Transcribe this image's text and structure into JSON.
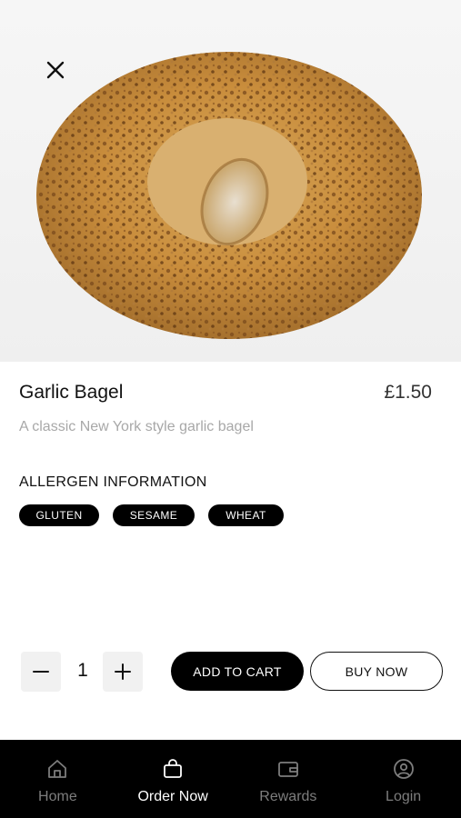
{
  "hero": {
    "image_name": "garlic-bagel-photo",
    "close_icon": "close-icon"
  },
  "product": {
    "name": "Garlic Bagel",
    "price": "£1.50",
    "description": "A classic New York style garlic bagel"
  },
  "allergens": {
    "heading": "ALLERGEN INFORMATION",
    "items": [
      "GLUTEN",
      "SESAME",
      "WHEAT"
    ]
  },
  "quantity": {
    "value": "1",
    "minus_icon": "minus-icon",
    "plus_icon": "plus-icon"
  },
  "actions": {
    "add_to_cart": "ADD TO CART",
    "buy_now": "BUY NOW"
  },
  "tabbar": {
    "tabs": [
      {
        "label": "Home",
        "icon": "home-icon",
        "active": false
      },
      {
        "label": "Order Now",
        "icon": "bag-icon",
        "active": true
      },
      {
        "label": "Rewards",
        "icon": "wallet-icon",
        "active": false
      },
      {
        "label": "Login",
        "icon": "user-icon",
        "active": false
      }
    ]
  },
  "colors": {
    "primary": "#000000",
    "background": "#ffffff",
    "muted_text": "#a8a8a8",
    "inactive_tab": "#7d7d7d"
  }
}
